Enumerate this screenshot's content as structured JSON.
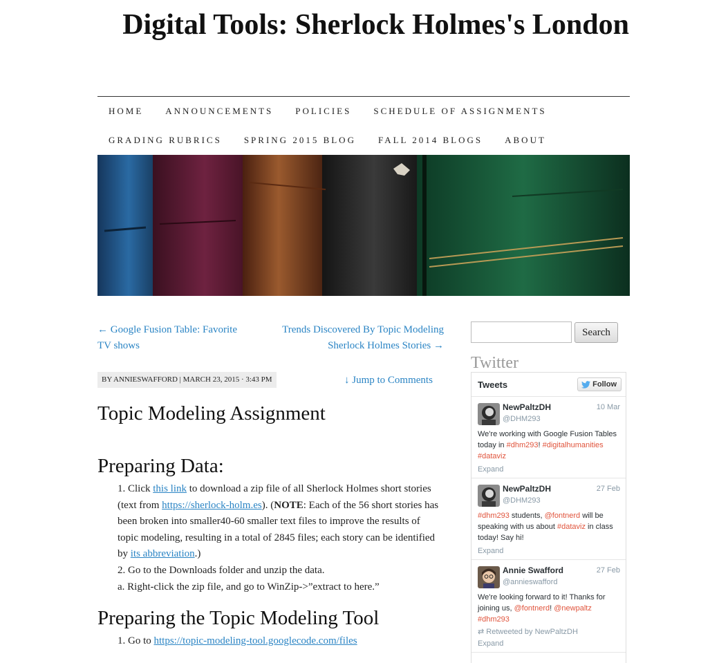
{
  "site": {
    "title": "Digital Tools: Sherlock Holmes's London"
  },
  "nav": {
    "row1": [
      "HOME",
      "ANNOUNCEMENTS",
      "POLICIES",
      "SCHEDULE OF ASSIGNMENTS"
    ],
    "row2": [
      "GRADING RUBRICS",
      "SPRING 2015 BLOG",
      "FALL 2014 BLOGS",
      "ABOUT"
    ]
  },
  "post_nav": {
    "prev_line1": "← Google Fusion Table: Favorite",
    "prev_line2": "TV shows",
    "next_line1": "Trends Discovered By Topic Modeling",
    "next_line2": "Sherlock Holmes Stories →"
  },
  "meta": {
    "byline": "BY ANNIESWAFFORD | MARCH 23, 2015 · 3:43 PM",
    "jump": "↓ Jump to Comments"
  },
  "post": {
    "title": "Topic Modeling Assignment",
    "h_prep": "Preparing Data:",
    "p1_a": "1. Click ",
    "p1_link1": "this link",
    "p1_b": " to download a zip file of all Sherlock Holmes short stories (text from ",
    "p1_link2": "https://sherlock-holm.es",
    "p1_c": "). (",
    "p1_note": "NOTE",
    "p1_d": ": Each of the 56 short stories has been broken into smaller40-60 smaller text files to improve the results of topic modeling, resulting in a total of 2845 files; each story can be identified by ",
    "p1_link3": "its abbreviation",
    "p1_e": ".)",
    "p2": "2. Go to the Downloads folder and unzip the data.",
    "p3": "a. Right-click the zip file, and go to WinZip->”extract to here.”",
    "h_tool": "Preparing the Topic Modeling Tool",
    "p4_a": "1. Go to ",
    "p4_link": "https://topic-modeling-tool.googlecode.com/files"
  },
  "sidebar": {
    "search_button": "Search",
    "widget_title": "Twitter",
    "tweets_label": "Tweets",
    "follow_label": "Follow",
    "tweets": [
      {
        "name": "NewPaltzDH",
        "handle": "@DHM293",
        "date": "10 Mar",
        "t1": "We're working with Google Fusion Tables today in ",
        "tag1": "#dhm293",
        "t2": "! ",
        "tag2": "#digitalhumanities",
        "t3": " ",
        "tag3": "#dataviz",
        "expand": "Expand"
      },
      {
        "name": "NewPaltzDH",
        "handle": "@DHM293",
        "date": "27 Feb",
        "tag1": "#dhm293",
        "t1": " students, ",
        "tag2": "@fontnerd",
        "t2": " will be speaking with us about ",
        "tag3": "#dataviz",
        "t3": " in class today! Say hi!",
        "expand": "Expand"
      },
      {
        "name": "Annie Swafford",
        "handle": "@annieswafford",
        "date": "27 Feb",
        "t1": "We're looking forward to it! Thanks for joining us, ",
        "tag1": "@fontnerd",
        "t2": "! ",
        "tag2": "@newpaltz",
        "t3": " ",
        "tag3": "#dhm293",
        "retweet": "Retweeted by NewPaltzDH",
        "expand": "Expand"
      }
    ]
  }
}
